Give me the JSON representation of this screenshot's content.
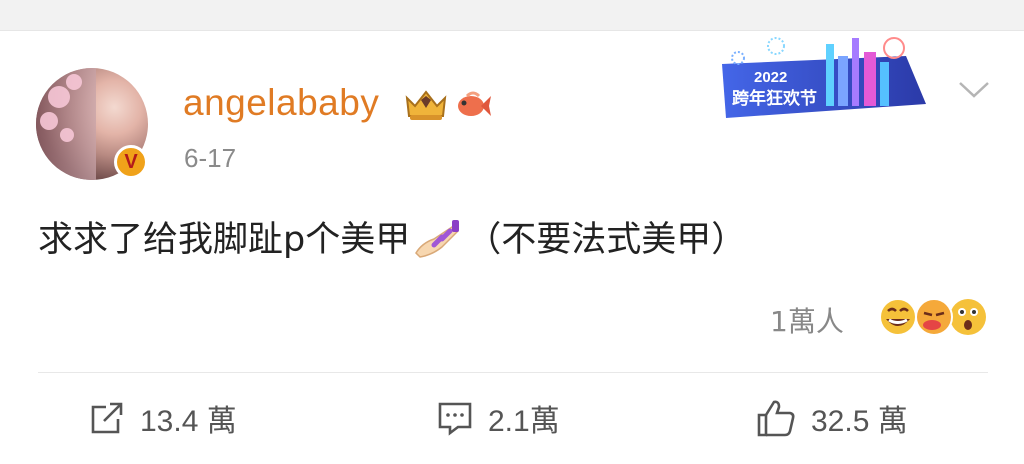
{
  "post": {
    "username": "angelababy",
    "date": "6-17",
    "text_before": "求求了给我脚趾p个美甲",
    "text_after": "（不要法式美甲）",
    "reactions_count": "1萬人"
  },
  "event_banner": {
    "year": "2022",
    "title": "跨年狂欢节"
  },
  "actions": {
    "repost": "13.4 萬",
    "comment": "2.1萬",
    "like": "32.5 萬"
  },
  "icons": {
    "verified": "verified-v-badge",
    "crown": "crown-badge-icon",
    "fish": "koi-fish-icon",
    "nail": "nail-polish-emoji",
    "more": "chevron-down-icon",
    "repost": "repost-icon",
    "comment": "comment-icon",
    "like": "thumbs-up-icon"
  },
  "colors": {
    "username": "#e07b24",
    "date": "#8a8a8a",
    "text": "#222222",
    "actions": "#555555"
  }
}
